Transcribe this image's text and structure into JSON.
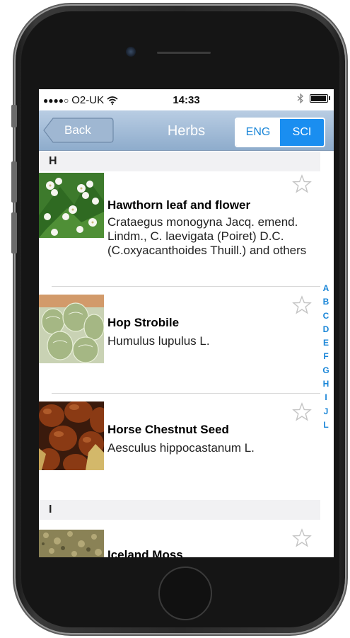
{
  "status": {
    "carrier": "O2-UK",
    "signal_dots": "●●●●○",
    "time": "14:33"
  },
  "nav": {
    "back_label": "Back",
    "title": "Herbs",
    "seg_eng": "ENG",
    "seg_sci": "SCI"
  },
  "sections": [
    {
      "letter": "H"
    },
    {
      "letter": "I"
    }
  ],
  "items": [
    {
      "title": "Hawthorn leaf and flower",
      "subtitle": "Crataegus monogyna Jacq. emend. Lindm., C. laevigata (Poiret) D.C. (C.oxyacanthoides Thuill.) and others"
    },
    {
      "title": "Hop Strobile",
      "subtitle": "Humulus lupulus L."
    },
    {
      "title": "Horse Chestnut Seed",
      "subtitle": "Aesculus hippocastanum L."
    },
    {
      "title": "Iceland Moss",
      "subtitle": ""
    }
  ],
  "index_letters": [
    "A",
    "B",
    "C",
    "D",
    "E",
    "F",
    "G",
    "H",
    "I",
    "J",
    "L"
  ],
  "colors": {
    "accent": "#1a8ef0",
    "nav_top": "#b9cde3",
    "nav_bottom": "#8eaccc"
  }
}
